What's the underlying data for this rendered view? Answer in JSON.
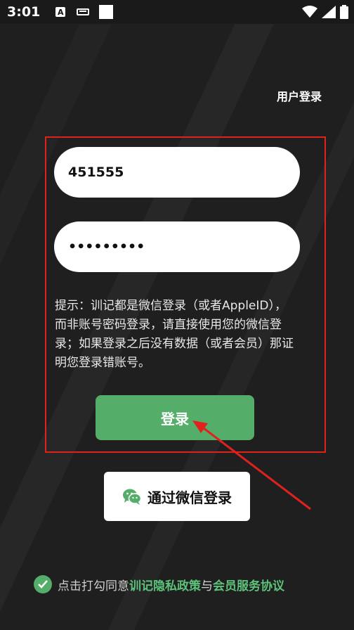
{
  "status_bar": {
    "time": "3:01",
    "a_badge": "A"
  },
  "header": {
    "tab_label": "用户登录"
  },
  "form": {
    "account_value": "451555",
    "password_value": "•••••••••",
    "hint": "提示：训记都是微信登录（或者AppleID），而非账号密码登录，请直接使用您的微信登录；如果登录之后没有数据（或者会员）那证明您登录错账号。",
    "login_label": "登录"
  },
  "wechat_login": {
    "label": "通过微信登录"
  },
  "agreement": {
    "prefix": "点击打勾同意",
    "privacy_link": "训记隐私政策",
    "and": "与",
    "member_link": "会员服务协议"
  },
  "colors": {
    "accent_green": "#55ad6a",
    "annotation_red": "#e0211d"
  }
}
